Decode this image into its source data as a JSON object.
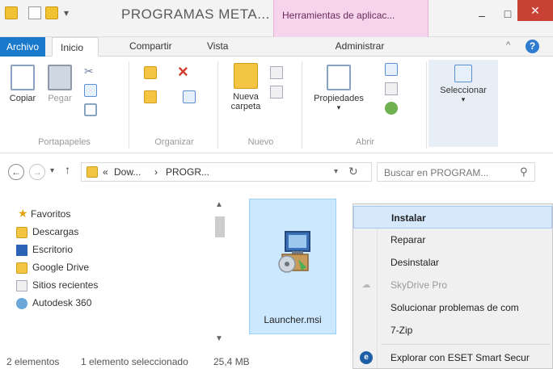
{
  "window": {
    "title": "PROGRAMAS META...",
    "contextual_tab_title": "Herramientas de aplicac...",
    "controls": {
      "minimize": "–",
      "maximize": "□",
      "close": "✕"
    }
  },
  "tabs": {
    "file": "Archivo",
    "home": "Inicio",
    "share": "Compartir",
    "view": "Vista",
    "manage": "Administrar"
  },
  "ribbon": {
    "clipboard": {
      "group": "Portapapeles",
      "copy": "Copiar",
      "paste": "Pegar"
    },
    "organize": {
      "group": "Organizar"
    },
    "new": {
      "group": "Nuevo",
      "new_folder_line1": "Nueva",
      "new_folder_line2": "carpeta"
    },
    "open": {
      "group": "Abrir",
      "properties": "Propiedades"
    },
    "select": {
      "select": "Seleccionar"
    }
  },
  "address": {
    "crumb_prefix": "«",
    "crumb_1": "Dow...",
    "separator": "›",
    "crumb_2": "PROGR...",
    "search_placeholder": "Buscar en PROGRAM..."
  },
  "nav": {
    "favorites": "Favoritos",
    "items": [
      "Descargas",
      "Escritorio",
      "Google Drive",
      "Sitios recientes",
      "Autodesk 360"
    ]
  },
  "content": {
    "file_name": "Launcher.msi"
  },
  "context_menu": {
    "items": [
      {
        "label": "Instalar",
        "highlighted": true,
        "enabled": true
      },
      {
        "label": "Reparar",
        "enabled": true
      },
      {
        "label": "Desinstalar",
        "enabled": true
      },
      {
        "label": "SkyDrive Pro",
        "enabled": false
      },
      {
        "label": "Solucionar problemas de com",
        "enabled": true
      },
      {
        "label": "7-Zip",
        "enabled": true
      },
      {
        "label": "Explorar con ESET Smart Secur",
        "enabled": true
      }
    ]
  },
  "status": {
    "count": "2 elementos",
    "selected": "1 elemento seleccionado",
    "size": "25,4 MB"
  },
  "colors": {
    "file_tab": "#1979ca",
    "context_tab": "#f6d4ec",
    "close_button": "#c94135",
    "selection": "#cce8ff",
    "menu_highlight": "#d6e8fb"
  }
}
